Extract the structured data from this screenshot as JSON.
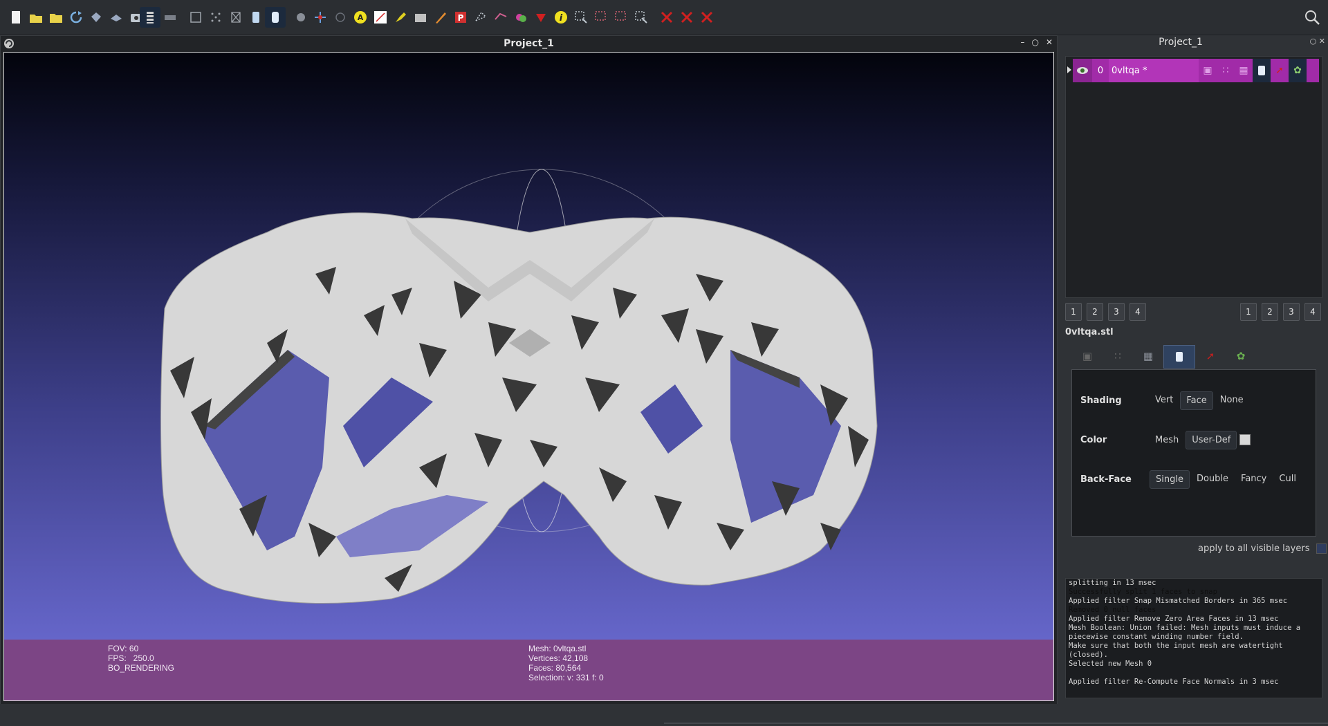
{
  "toolbar": {
    "tools": [
      {
        "name": "new-project",
        "icon": "new-document-icon",
        "color": "#f2f2f2"
      },
      {
        "name": "open-project",
        "icon": "folder-open-icon",
        "color": "#e8d24a"
      },
      {
        "name": "import-mesh",
        "icon": "folder-icon",
        "color": "#e8d24a"
      },
      {
        "name": "reload",
        "icon": "reload-icon",
        "color": "#7ab0e0"
      },
      {
        "name": "save",
        "icon": "save-icon",
        "color": "#9aa8c0"
      },
      {
        "name": "export",
        "icon": "export-icon",
        "color": "#9aa8c0"
      },
      {
        "name": "snapshot",
        "icon": "camera-icon",
        "color": "#c0c8d0"
      },
      {
        "name": "layers",
        "icon": "layers-icon",
        "color": "#d0d0d0",
        "active": true
      },
      {
        "name": "raster",
        "icon": "raster-icon",
        "color": "#7a7f88"
      },
      {
        "name": "bbox",
        "icon": "bbox-icon",
        "color": "#a0a5ac"
      },
      {
        "name": "points",
        "icon": "points-icon",
        "color": "#a0a5ac"
      },
      {
        "name": "wireframe",
        "icon": "wireframe-icon",
        "color": "#a0a5ac"
      },
      {
        "name": "flat",
        "icon": "flat-shade-icon",
        "color": "#c0d8f0"
      },
      {
        "name": "smooth",
        "icon": "smooth-shade-icon",
        "color": "#e0ecfa",
        "active": true
      },
      {
        "name": "lighting",
        "icon": "lighting-icon",
        "color": "#8a8f98"
      },
      {
        "name": "axes",
        "icon": "axes-icon",
        "color": "#6aa0e0"
      },
      {
        "name": "trackball",
        "icon": "trackball-icon",
        "color": "#6a6f78"
      },
      {
        "name": "annotate",
        "icon": "annotation-icon",
        "color": "#f0e020"
      },
      {
        "name": "measure",
        "icon": "measure-icon",
        "color": "#ffffff"
      },
      {
        "name": "paint",
        "icon": "paint-icon",
        "color": "#e0d020"
      },
      {
        "name": "raster-align",
        "icon": "align-icon",
        "color": "#c0c0c0"
      },
      {
        "name": "brush",
        "icon": "brush-icon",
        "color": "#e08a30"
      },
      {
        "name": "pick-points",
        "icon": "pick-points-icon",
        "color": "#d03030"
      },
      {
        "name": "select-faces",
        "icon": "select-faces-icon",
        "color": "#c0c8d0"
      },
      {
        "name": "select-vertices",
        "icon": "select-vertices-icon",
        "color": "#d06090"
      },
      {
        "name": "color-paint",
        "icon": "color-paint-icon",
        "color": "#d040a0"
      },
      {
        "name": "connected",
        "icon": "connected-icon",
        "color": "#d02020"
      },
      {
        "name": "info",
        "icon": "info-icon",
        "color": "#f0e020"
      },
      {
        "name": "select-area",
        "icon": "select-area-icon",
        "color": "#c0c8d0"
      },
      {
        "name": "select-vert-area",
        "icon": "select-vert-area-icon",
        "color": "#d06070"
      },
      {
        "name": "select-face-area",
        "icon": "select-face-area-icon",
        "color": "#d06070"
      },
      {
        "name": "select-connected",
        "icon": "select-connected-icon",
        "color": "#c0c8d0"
      },
      {
        "name": "delete-selection",
        "icon": "delete-icon",
        "color": "#d02020"
      },
      {
        "name": "delete-vertices",
        "icon": "delete-vertices-icon",
        "color": "#d02020"
      },
      {
        "name": "delete-faces",
        "icon": "delete-faces-icon",
        "color": "#d02020"
      }
    ]
  },
  "viewport": {
    "title": "Project_1",
    "info_left": [
      "FOV: 60",
      "FPS:   250.0",
      "BO_RENDERING"
    ],
    "info_mid": [
      "Mesh: 0vltqa.stl",
      "Vertices: 42,108",
      "Faces: 80,564",
      "Selection: v: 331 f: 0"
    ],
    "colors": {
      "sky_top": "#03040c",
      "sky_bottom": "#7070da",
      "info_bar": "#7c4585",
      "mesh": "#d8d8d8"
    }
  },
  "project_panel": {
    "title": "Project_1",
    "layer": {
      "index": "0",
      "name": "0vltqa *",
      "color": "#a12ba8"
    },
    "page_buttons": [
      "1",
      "2",
      "3",
      "4"
    ],
    "file_name": "0vltqa.stl"
  },
  "render": {
    "shading_label": "Shading",
    "shading_opts": [
      "Vert",
      "Face",
      "None"
    ],
    "shading_selected": "Face",
    "color_label": "Color",
    "color_opts": [
      "Mesh",
      "User-Def"
    ],
    "color_selected": "User-Def",
    "backface_label": "Back-Face",
    "backface_opts": [
      "Single",
      "Double",
      "Fancy",
      "Cull"
    ],
    "backface_selected": "Single",
    "apply_label": "apply to all visible layers"
  },
  "log": [
    {
      "text": "splitting in 13 msec",
      "dim": false
    },
    {
      "text": "Successfully split 1 faces to snap",
      "dim": true
    },
    {
      "text": "Applied filter Snap Mismatched Borders in 365 msec",
      "dim": false
    },
    {
      "text": "Removed 0 null faces",
      "dim": true
    },
    {
      "text": "Applied filter Remove Zero Area Faces in 13 msec",
      "dim": false
    },
    {
      "text": "Mesh Boolean: Union failed: Mesh inputs must induce a",
      "dim": false
    },
    {
      "text": "piecewise constant winding number field.",
      "dim": false
    },
    {
      "text": "Make sure that both the input mesh are watertight",
      "dim": false
    },
    {
      "text": "(closed).",
      "dim": false
    },
    {
      "text": "Selected new Mesh 0",
      "dim": false
    },
    {
      "text": "",
      "dim": false
    },
    {
      "text": "Applied filter Re-Compute Face Normals in 3 msec",
      "dim": false
    }
  ]
}
